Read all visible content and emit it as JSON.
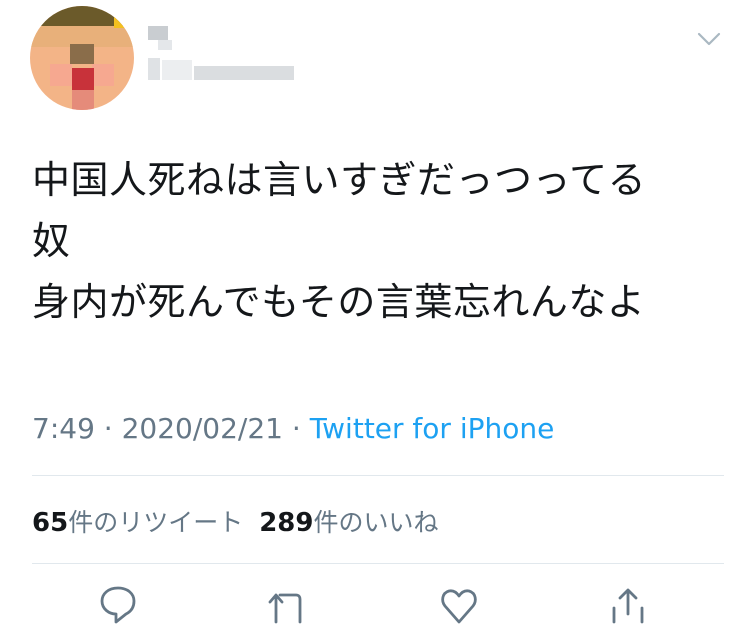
{
  "tweet": {
    "text": "中国人死ねは言いすぎだっつってる\n奴\n身内が死んでもその言葉忘れんなよ",
    "time": "7:49",
    "sep1": " · ",
    "date": "2020/02/21",
    "sep2": " · ",
    "source": "Twitter for iPhone"
  },
  "stats": {
    "retweets_count": "65",
    "retweets_label": "件のリツイート",
    "likes_count": "289",
    "likes_label": "件のいいね"
  },
  "icons": {
    "more": "chevron-down-icon",
    "reply": "reply-icon",
    "retweet": "retweet-icon",
    "like": "heart-icon",
    "share": "share-icon"
  },
  "colors": {
    "text": "#14171a",
    "secondary": "#657786",
    "link": "#1da1f2",
    "divider": "#e1e8ed",
    "icon": "#657786"
  }
}
